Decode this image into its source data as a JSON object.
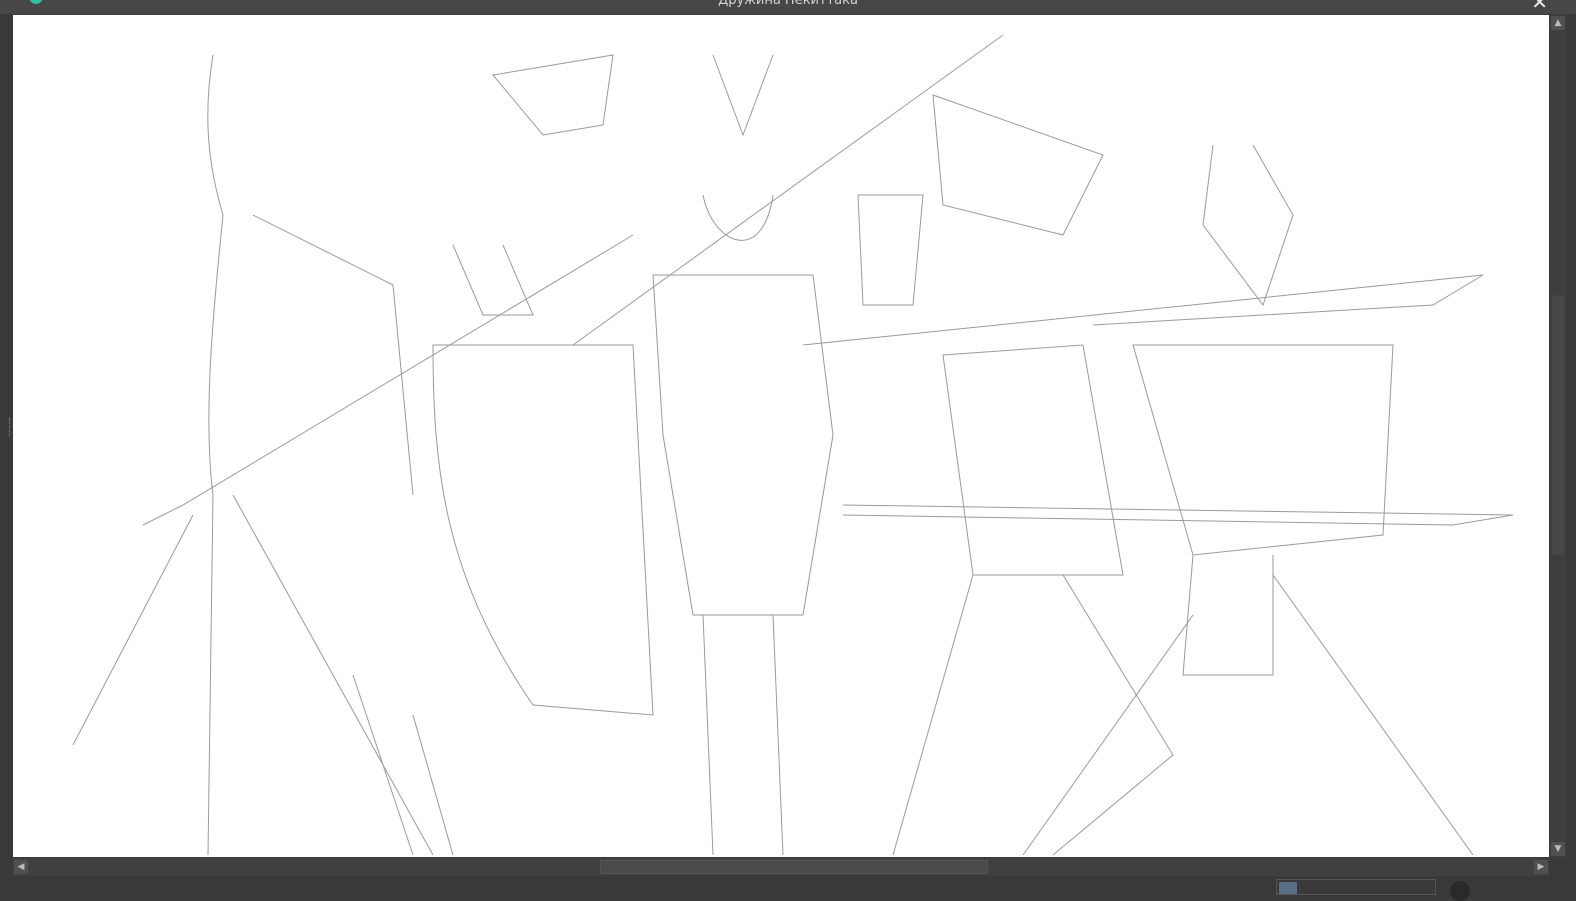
{
  "window": {
    "title": "Дружина Некиттака",
    "close_icon": "close-icon",
    "app_icon": "app-logo-icon"
  },
  "canvas": {
    "content": "pencil sketch of five horned warriors"
  },
  "scrollbars": {
    "up": "▲",
    "down": "▼",
    "left": "◀",
    "right": "▶"
  }
}
